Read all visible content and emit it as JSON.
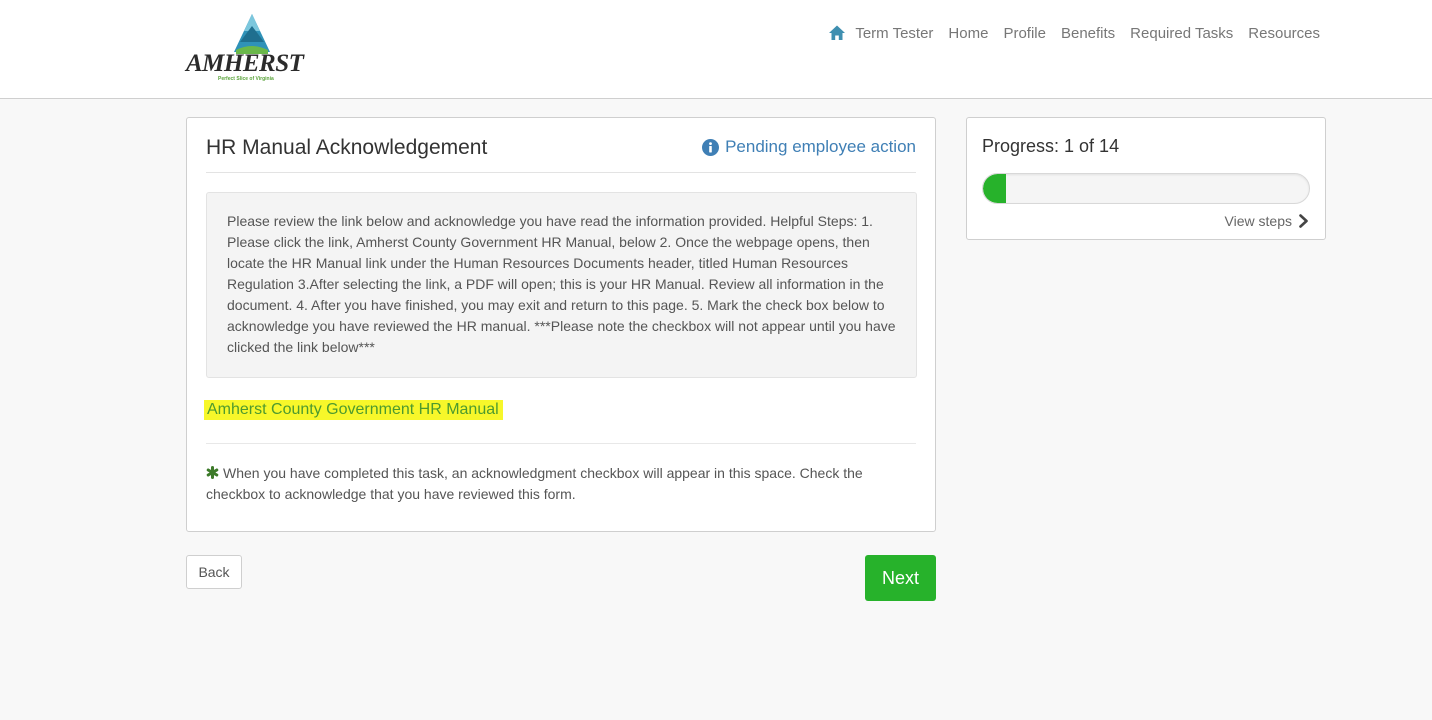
{
  "header": {
    "logo_text": "AMHERST",
    "logo_tagline": "Perfect Slice of Virginia",
    "user_name": "Term Tester",
    "nav_items": [
      "Home",
      "Profile",
      "Benefits",
      "Required Tasks",
      "Resources"
    ]
  },
  "task": {
    "title": "HR Manual Acknowledgement",
    "status": "Pending employee action",
    "instructions": "Please review the link below and acknowledge you have read the information provided. Helpful Steps: 1. Please click the link, Amherst County Government HR Manual, below 2. Once the webpage opens, then locate the HR Manual link under the Human Resources Documents header, titled Human Resources Regulation 3.After selecting the link, a PDF will open; this is your HR Manual. Review all information in the document. 4. After you have finished, you may exit and return to this page. 5. Mark the check box below to acknowledge you have reviewed the HR manual. ***Please note the checkbox will not appear until you have clicked the link below***",
    "link_text": "Amherst County Government HR Manual",
    "note": "When you have completed this task, an acknowledgment checkbox will appear in this space. Check the checkbox to acknowledge that you have reviewed this form."
  },
  "buttons": {
    "back": "Back",
    "next": "Next"
  },
  "progress": {
    "label": "Progress: 1 of 14",
    "current": 1,
    "total": 14,
    "view_steps": "View steps"
  },
  "colors": {
    "accent_green": "#27b22b",
    "link_blue": "#3f7fb5",
    "highlight_yellow": "#f7f72a"
  }
}
